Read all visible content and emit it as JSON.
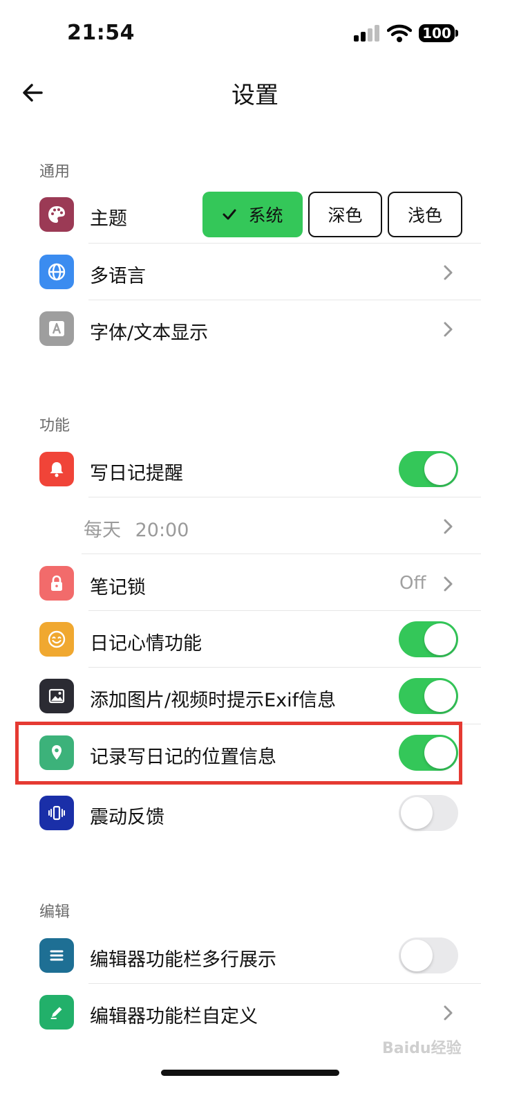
{
  "status_bar": {
    "time": "21:54",
    "battery": "100"
  },
  "header": {
    "title": "设置"
  },
  "sections": {
    "general": "通用",
    "features": "功能",
    "editing": "编辑"
  },
  "theme": {
    "label": "主题",
    "options": [
      "系统",
      "深色",
      "浅色"
    ],
    "selected": "系统"
  },
  "rows": {
    "language": "多语言",
    "font": "字体/文本显示",
    "reminder": "写日记提醒",
    "reminder_schedule": "每天 20:00",
    "note_lock": "笔记锁",
    "note_lock_value": "Off",
    "mood": "日记心情功能",
    "exif": "添加图片/视频时提示Exif信息",
    "location": "记录写日记的位置信息",
    "haptics": "震动反馈",
    "toolbar_multiline": "编辑器功能栏多行展示",
    "toolbar_custom": "编辑器功能栏自定义"
  },
  "toggles": {
    "reminder": true,
    "mood": true,
    "exif": true,
    "location": true,
    "haptics": false,
    "toolbar_multiline": false
  },
  "colors": {
    "accent_green": "#34c759",
    "highlight_red": "#e53a32",
    "theme_icon": "#9b3a55",
    "language_icon": "#3b8cf0",
    "font_icon": "#9e9e9e",
    "reminder_icon": "#f04438",
    "lock_icon": "#f26b6b",
    "mood_icon": "#f0a830",
    "exif_icon": "#2b2b33",
    "location_icon": "#3cb27a",
    "haptics_icon": "#1a2fa8",
    "multiline_icon": "#1e6f94",
    "custom_icon": "#22b06a"
  },
  "icons": [
    "palette-icon",
    "globe-icon",
    "font-icon",
    "bell-icon",
    "lock-icon",
    "smile-icon",
    "image-icon",
    "location-pin-icon",
    "vibrate-icon",
    "menu-icon",
    "pencil-icon"
  ],
  "watermark": "Baidu经验"
}
